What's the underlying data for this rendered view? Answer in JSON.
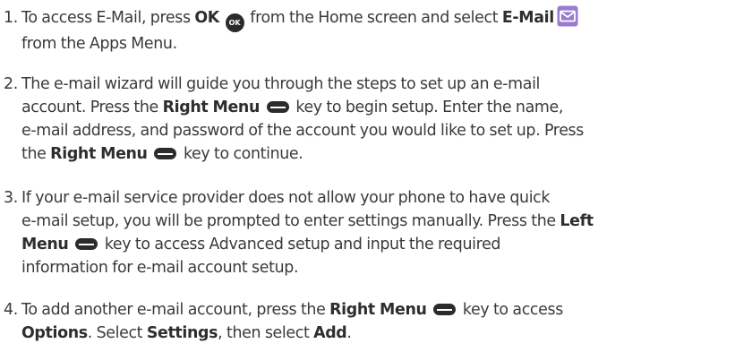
{
  "icons": {
    "ok_button": "ok-button-icon",
    "email_app": "email-app-icon",
    "menu_key": "menu-key-icon"
  },
  "colors": {
    "text": "#3a3a3a",
    "email_icon": "#9b7bd0",
    "key_icon": "#2b2b2b"
  },
  "steps": [
    {
      "number": "1.",
      "t1": "To access E-Mail, press ",
      "b1": "OK",
      "ok_label": "OK",
      "t2": " from the Home screen and select ",
      "b2": "E-Mail",
      "t3": "from the Apps Menu."
    },
    {
      "number": "2.",
      "t1": "The e-mail wizard will guide you through the steps to set up an e-mail",
      "t2": "account. Press the ",
      "b1": "Right Menu",
      "t3": " key to begin setup. Enter the name,",
      "t4": "e-mail address, and password of the account you would like to set up. Press",
      "t5": "the ",
      "b2": "Right Menu",
      "t6": " key to continue."
    },
    {
      "number": "3.",
      "t1": "If your e-mail service provider does not allow your phone to have quick",
      "t2": "e-mail setup, you will be prompted to enter settings manually. Press the ",
      "b1a": "Left",
      "b1b": "Menu",
      "t3": " key to access Advanced setup and input the required",
      "t4": "information for e-mail account setup."
    },
    {
      "number": "4.",
      "t1": "To add another e-mail account, press the ",
      "b1": "Right Menu",
      "t2": " key to access",
      "b2": "Options",
      "t3": ". Select ",
      "b3": "Settings",
      "t4": ", then select ",
      "b4": "Add",
      "t5": "."
    }
  ]
}
